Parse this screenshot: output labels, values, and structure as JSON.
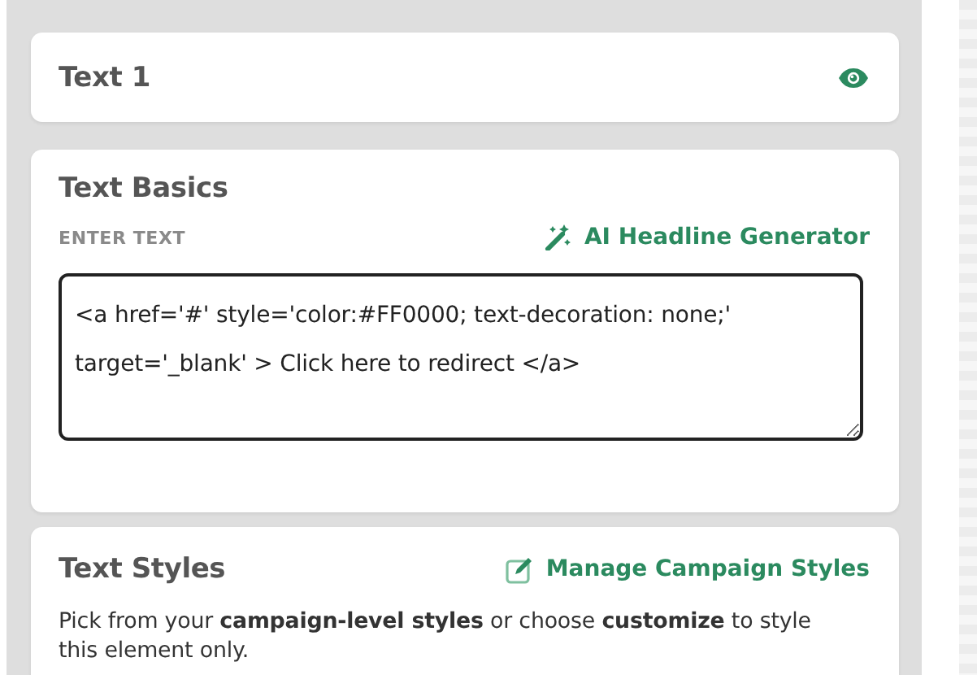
{
  "element_header": {
    "title": "Text 1",
    "visible": true
  },
  "text_basics": {
    "title": "Text Basics",
    "field_label": "ENTER TEXT",
    "ai_link": "AI Headline Generator",
    "value": "<a href='#' style='color:#FF0000; text-decoration: none;' target='_blank' > Click here to redirect </a>"
  },
  "text_styles": {
    "title": "Text Styles",
    "manage_link": "Manage Campaign Styles",
    "description": "Pick from your **campaign-level styles** or choose **customize** to style this element only."
  }
}
